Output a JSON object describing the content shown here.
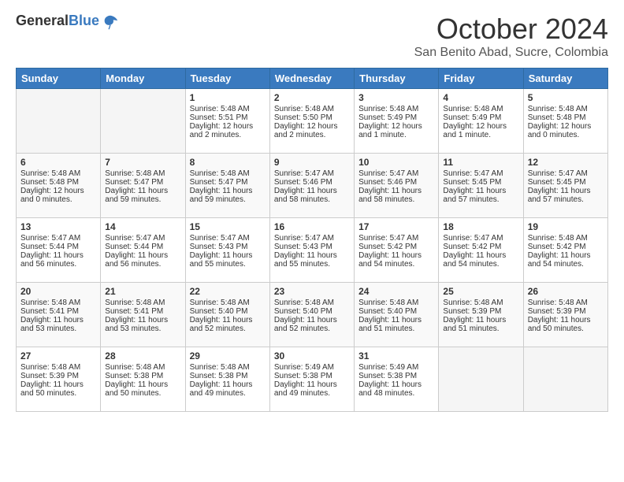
{
  "header": {
    "logo_general": "General",
    "logo_blue": "Blue",
    "month": "October 2024",
    "location": "San Benito Abad, Sucre, Colombia"
  },
  "days_of_week": [
    "Sunday",
    "Monday",
    "Tuesday",
    "Wednesday",
    "Thursday",
    "Friday",
    "Saturday"
  ],
  "weeks": [
    [
      {
        "day": "",
        "sunrise": "",
        "sunset": "",
        "daylight": "",
        "empty": true
      },
      {
        "day": "",
        "sunrise": "",
        "sunset": "",
        "daylight": "",
        "empty": true
      },
      {
        "day": "1",
        "sunrise": "Sunrise: 5:48 AM",
        "sunset": "Sunset: 5:51 PM",
        "daylight": "Daylight: 12 hours and 2 minutes.",
        "empty": false
      },
      {
        "day": "2",
        "sunrise": "Sunrise: 5:48 AM",
        "sunset": "Sunset: 5:50 PM",
        "daylight": "Daylight: 12 hours and 2 minutes.",
        "empty": false
      },
      {
        "day": "3",
        "sunrise": "Sunrise: 5:48 AM",
        "sunset": "Sunset: 5:49 PM",
        "daylight": "Daylight: 12 hours and 1 minute.",
        "empty": false
      },
      {
        "day": "4",
        "sunrise": "Sunrise: 5:48 AM",
        "sunset": "Sunset: 5:49 PM",
        "daylight": "Daylight: 12 hours and 1 minute.",
        "empty": false
      },
      {
        "day": "5",
        "sunrise": "Sunrise: 5:48 AM",
        "sunset": "Sunset: 5:48 PM",
        "daylight": "Daylight: 12 hours and 0 minutes.",
        "empty": false
      }
    ],
    [
      {
        "day": "6",
        "sunrise": "Sunrise: 5:48 AM",
        "sunset": "Sunset: 5:48 PM",
        "daylight": "Daylight: 12 hours and 0 minutes.",
        "empty": false
      },
      {
        "day": "7",
        "sunrise": "Sunrise: 5:48 AM",
        "sunset": "Sunset: 5:47 PM",
        "daylight": "Daylight: 11 hours and 59 minutes.",
        "empty": false
      },
      {
        "day": "8",
        "sunrise": "Sunrise: 5:48 AM",
        "sunset": "Sunset: 5:47 PM",
        "daylight": "Daylight: 11 hours and 59 minutes.",
        "empty": false
      },
      {
        "day": "9",
        "sunrise": "Sunrise: 5:47 AM",
        "sunset": "Sunset: 5:46 PM",
        "daylight": "Daylight: 11 hours and 58 minutes.",
        "empty": false
      },
      {
        "day": "10",
        "sunrise": "Sunrise: 5:47 AM",
        "sunset": "Sunset: 5:46 PM",
        "daylight": "Daylight: 11 hours and 58 minutes.",
        "empty": false
      },
      {
        "day": "11",
        "sunrise": "Sunrise: 5:47 AM",
        "sunset": "Sunset: 5:45 PM",
        "daylight": "Daylight: 11 hours and 57 minutes.",
        "empty": false
      },
      {
        "day": "12",
        "sunrise": "Sunrise: 5:47 AM",
        "sunset": "Sunset: 5:45 PM",
        "daylight": "Daylight: 11 hours and 57 minutes.",
        "empty": false
      }
    ],
    [
      {
        "day": "13",
        "sunrise": "Sunrise: 5:47 AM",
        "sunset": "Sunset: 5:44 PM",
        "daylight": "Daylight: 11 hours and 56 minutes.",
        "empty": false
      },
      {
        "day": "14",
        "sunrise": "Sunrise: 5:47 AM",
        "sunset": "Sunset: 5:44 PM",
        "daylight": "Daylight: 11 hours and 56 minutes.",
        "empty": false
      },
      {
        "day": "15",
        "sunrise": "Sunrise: 5:47 AM",
        "sunset": "Sunset: 5:43 PM",
        "daylight": "Daylight: 11 hours and 55 minutes.",
        "empty": false
      },
      {
        "day": "16",
        "sunrise": "Sunrise: 5:47 AM",
        "sunset": "Sunset: 5:43 PM",
        "daylight": "Daylight: 11 hours and 55 minutes.",
        "empty": false
      },
      {
        "day": "17",
        "sunrise": "Sunrise: 5:47 AM",
        "sunset": "Sunset: 5:42 PM",
        "daylight": "Daylight: 11 hours and 54 minutes.",
        "empty": false
      },
      {
        "day": "18",
        "sunrise": "Sunrise: 5:47 AM",
        "sunset": "Sunset: 5:42 PM",
        "daylight": "Daylight: 11 hours and 54 minutes.",
        "empty": false
      },
      {
        "day": "19",
        "sunrise": "Sunrise: 5:48 AM",
        "sunset": "Sunset: 5:42 PM",
        "daylight": "Daylight: 11 hours and 54 minutes.",
        "empty": false
      }
    ],
    [
      {
        "day": "20",
        "sunrise": "Sunrise: 5:48 AM",
        "sunset": "Sunset: 5:41 PM",
        "daylight": "Daylight: 11 hours and 53 minutes.",
        "empty": false
      },
      {
        "day": "21",
        "sunrise": "Sunrise: 5:48 AM",
        "sunset": "Sunset: 5:41 PM",
        "daylight": "Daylight: 11 hours and 53 minutes.",
        "empty": false
      },
      {
        "day": "22",
        "sunrise": "Sunrise: 5:48 AM",
        "sunset": "Sunset: 5:40 PM",
        "daylight": "Daylight: 11 hours and 52 minutes.",
        "empty": false
      },
      {
        "day": "23",
        "sunrise": "Sunrise: 5:48 AM",
        "sunset": "Sunset: 5:40 PM",
        "daylight": "Daylight: 11 hours and 52 minutes.",
        "empty": false
      },
      {
        "day": "24",
        "sunrise": "Sunrise: 5:48 AM",
        "sunset": "Sunset: 5:40 PM",
        "daylight": "Daylight: 11 hours and 51 minutes.",
        "empty": false
      },
      {
        "day": "25",
        "sunrise": "Sunrise: 5:48 AM",
        "sunset": "Sunset: 5:39 PM",
        "daylight": "Daylight: 11 hours and 51 minutes.",
        "empty": false
      },
      {
        "day": "26",
        "sunrise": "Sunrise: 5:48 AM",
        "sunset": "Sunset: 5:39 PM",
        "daylight": "Daylight: 11 hours and 50 minutes.",
        "empty": false
      }
    ],
    [
      {
        "day": "27",
        "sunrise": "Sunrise: 5:48 AM",
        "sunset": "Sunset: 5:39 PM",
        "daylight": "Daylight: 11 hours and 50 minutes.",
        "empty": false
      },
      {
        "day": "28",
        "sunrise": "Sunrise: 5:48 AM",
        "sunset": "Sunset: 5:38 PM",
        "daylight": "Daylight: 11 hours and 50 minutes.",
        "empty": false
      },
      {
        "day": "29",
        "sunrise": "Sunrise: 5:48 AM",
        "sunset": "Sunset: 5:38 PM",
        "daylight": "Daylight: 11 hours and 49 minutes.",
        "empty": false
      },
      {
        "day": "30",
        "sunrise": "Sunrise: 5:49 AM",
        "sunset": "Sunset: 5:38 PM",
        "daylight": "Daylight: 11 hours and 49 minutes.",
        "empty": false
      },
      {
        "day": "31",
        "sunrise": "Sunrise: 5:49 AM",
        "sunset": "Sunset: 5:38 PM",
        "daylight": "Daylight: 11 hours and 48 minutes.",
        "empty": false
      },
      {
        "day": "",
        "sunrise": "",
        "sunset": "",
        "daylight": "",
        "empty": true
      },
      {
        "day": "",
        "sunrise": "",
        "sunset": "",
        "daylight": "",
        "empty": true
      }
    ]
  ]
}
